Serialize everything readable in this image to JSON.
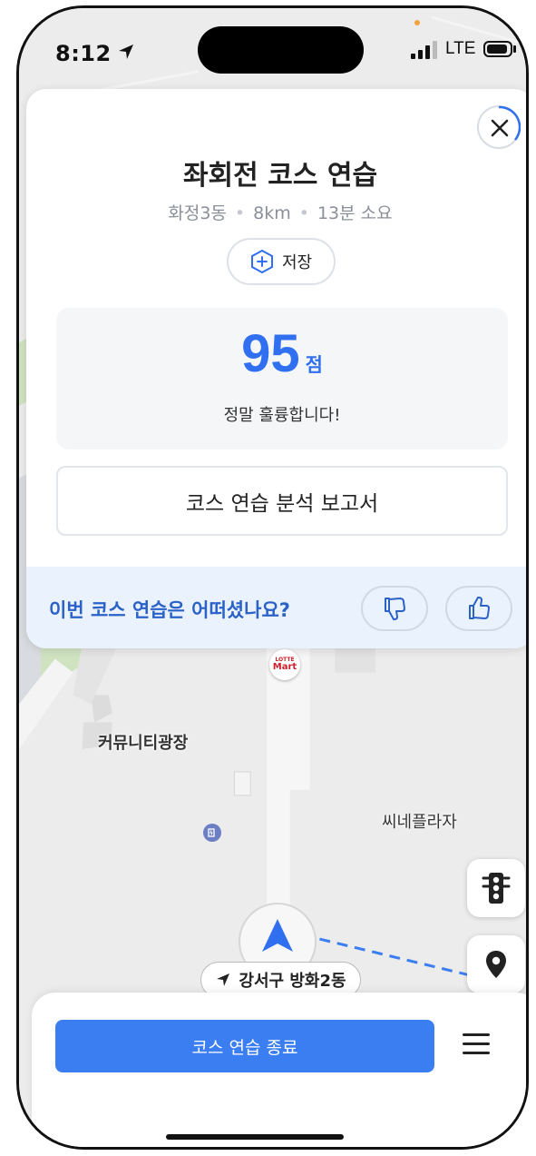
{
  "status_bar": {
    "time": "8:12",
    "network": "LTE"
  },
  "course": {
    "title": "좌회전 코스 연습",
    "location": "화정3동",
    "distance": "8km",
    "duration": "13분 소요",
    "save_label": "저장"
  },
  "score": {
    "value": "95",
    "unit": "점",
    "message": "정말 훌륭합니다!"
  },
  "report_button": "코스 연습 분석 보고서",
  "feedback": {
    "question": "이번 코스 연습은 어떠셨나요?"
  },
  "map": {
    "labels": {
      "lotte_top": "LOTTE",
      "lotte_bottom": "Mart",
      "community": "커뮤니티광장",
      "cinema": "씨네플라자"
    },
    "current_location": "강서구 방화2동"
  },
  "bottom_bar": {
    "end_button": "코스 연습 종료"
  },
  "colors": {
    "accent": "#3b7ef2",
    "score": "#2f6ff0",
    "feedback_bg": "#eaf2fd",
    "feedback_text": "#2a62c8"
  }
}
